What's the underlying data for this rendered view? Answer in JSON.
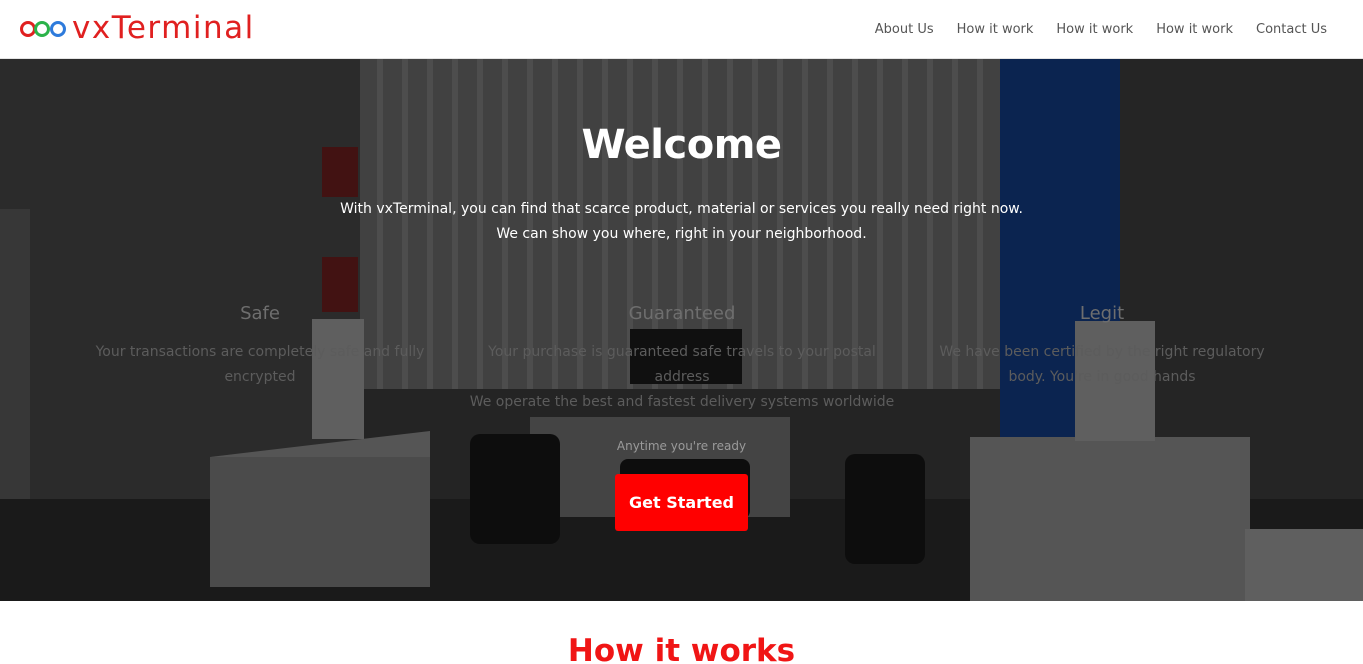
{
  "brand": {
    "name": "vxTerminal",
    "colors": {
      "text": "#e02020",
      "ring1": "#e02020",
      "ring2": "#2bb34a",
      "ring3": "#2e7bdc"
    }
  },
  "nav": {
    "items": [
      {
        "label": "About Us"
      },
      {
        "label": "How it work"
      },
      {
        "label": "How it work"
      },
      {
        "label": "How it work"
      },
      {
        "label": "Contact Us"
      }
    ]
  },
  "hero": {
    "title": "Welcome",
    "intro_line1": "With vxTerminal, you can find that scarce product, material or services you really need right now.",
    "intro_line2": "We can show you where, right in your neighborhood.",
    "features": [
      {
        "title": "Safe",
        "text": "Your transactions are completely safe and fully encrypted"
      },
      {
        "title": "Guaranteed",
        "text": "Your purchase is guaranteed safe travels to your postal address",
        "text2": "We operate the best and fastest delivery systems worldwide"
      },
      {
        "title": "Legit",
        "text": "We have been certified by the right regulatory body. You're in good hands"
      }
    ],
    "tagline": "Anytime you're ready",
    "cta_label": "Get Started",
    "cta_color": "#ff0000"
  },
  "how_it_works": {
    "title": "How it works",
    "color": "#f01515"
  }
}
